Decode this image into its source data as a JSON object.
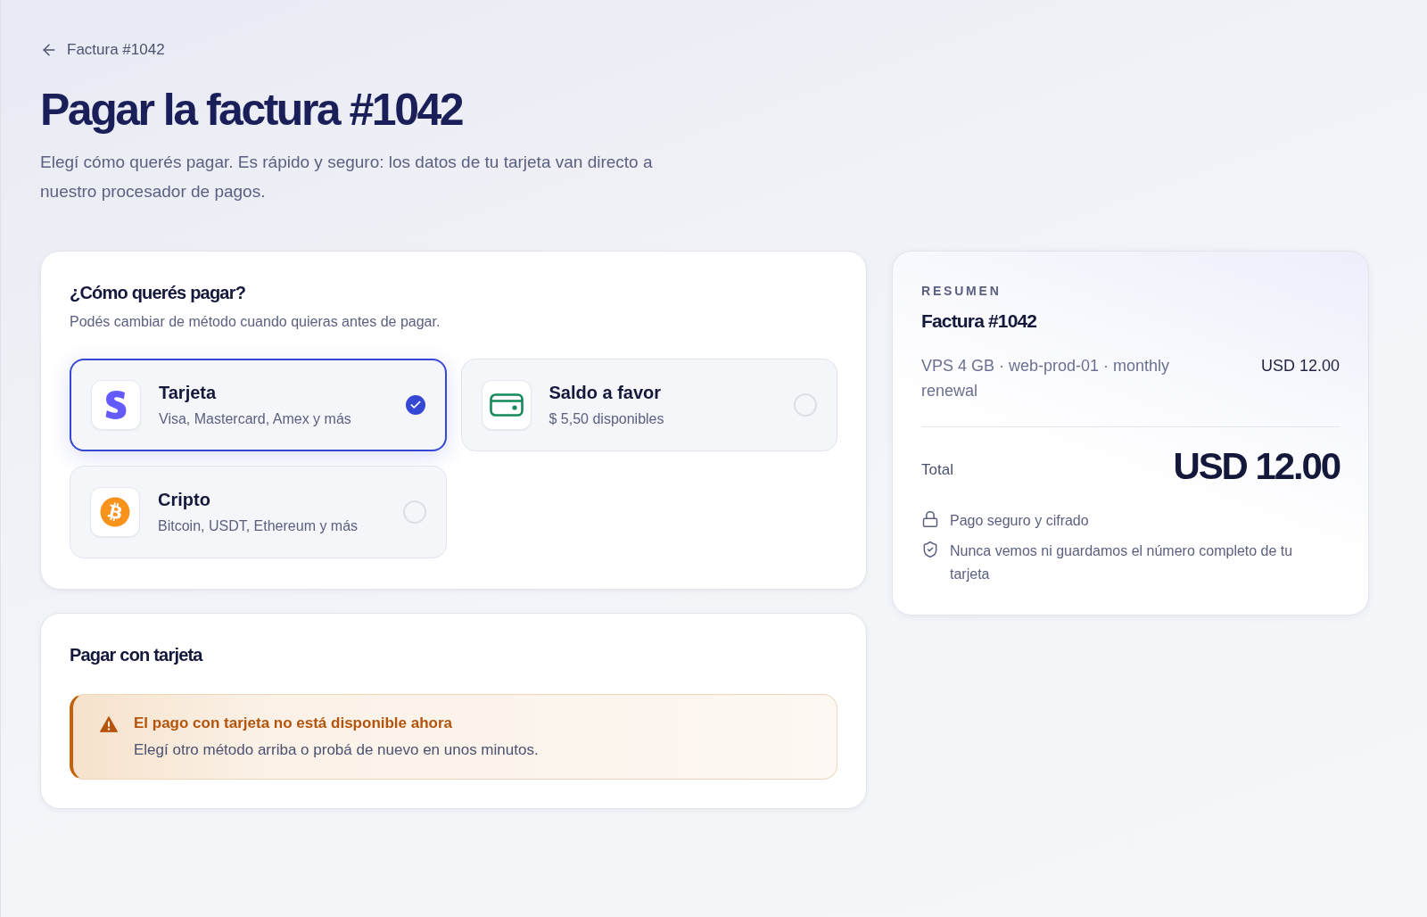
{
  "back_link": {
    "label": "Factura #1042"
  },
  "title": "Pagar la factura #1042",
  "subtitle": "Elegí cómo querés pagar. Es rápido y seguro: los datos de tu tarjeta van directo a nuestro procesador de pagos.",
  "method_card": {
    "title": "¿Cómo querés pagar?",
    "subtitle": "Podés cambiar de método cuando quieras antes de pagar.",
    "options": [
      {
        "kind": "card",
        "title": "Tarjeta",
        "subtitle": "Visa, Mastercard, Amex y más",
        "selected": true
      },
      {
        "kind": "balance",
        "title": "Saldo a favor",
        "subtitle": "$ 5,50 disponibles",
        "selected": false
      },
      {
        "kind": "crypto",
        "title": "Cripto",
        "subtitle": "Bitcoin, USDT, Ethereum y más",
        "selected": false
      }
    ]
  },
  "card_payment": {
    "title": "Pagar con tarjeta",
    "alert": {
      "kind": "warning",
      "title": "El pago con tarjeta no está disponible ahora",
      "message": "Elegí otro método arriba o probá de nuevo en unos minutos."
    }
  },
  "summary": {
    "eyebrow": "RESUMEN",
    "title": "Factura #1042",
    "items": [
      {
        "description": "VPS 4 GB · web-prod-01 · monthly renewal",
        "amount": "USD 12.00"
      }
    ],
    "total": {
      "label": "Total",
      "amount": "USD 12.00"
    },
    "notes": [
      {
        "kind": "lock",
        "text": "Pago seguro y cifrado"
      },
      {
        "kind": "shield",
        "text": "Nunca vemos ni guardamos el número completo de tu tarjeta"
      }
    ]
  }
}
